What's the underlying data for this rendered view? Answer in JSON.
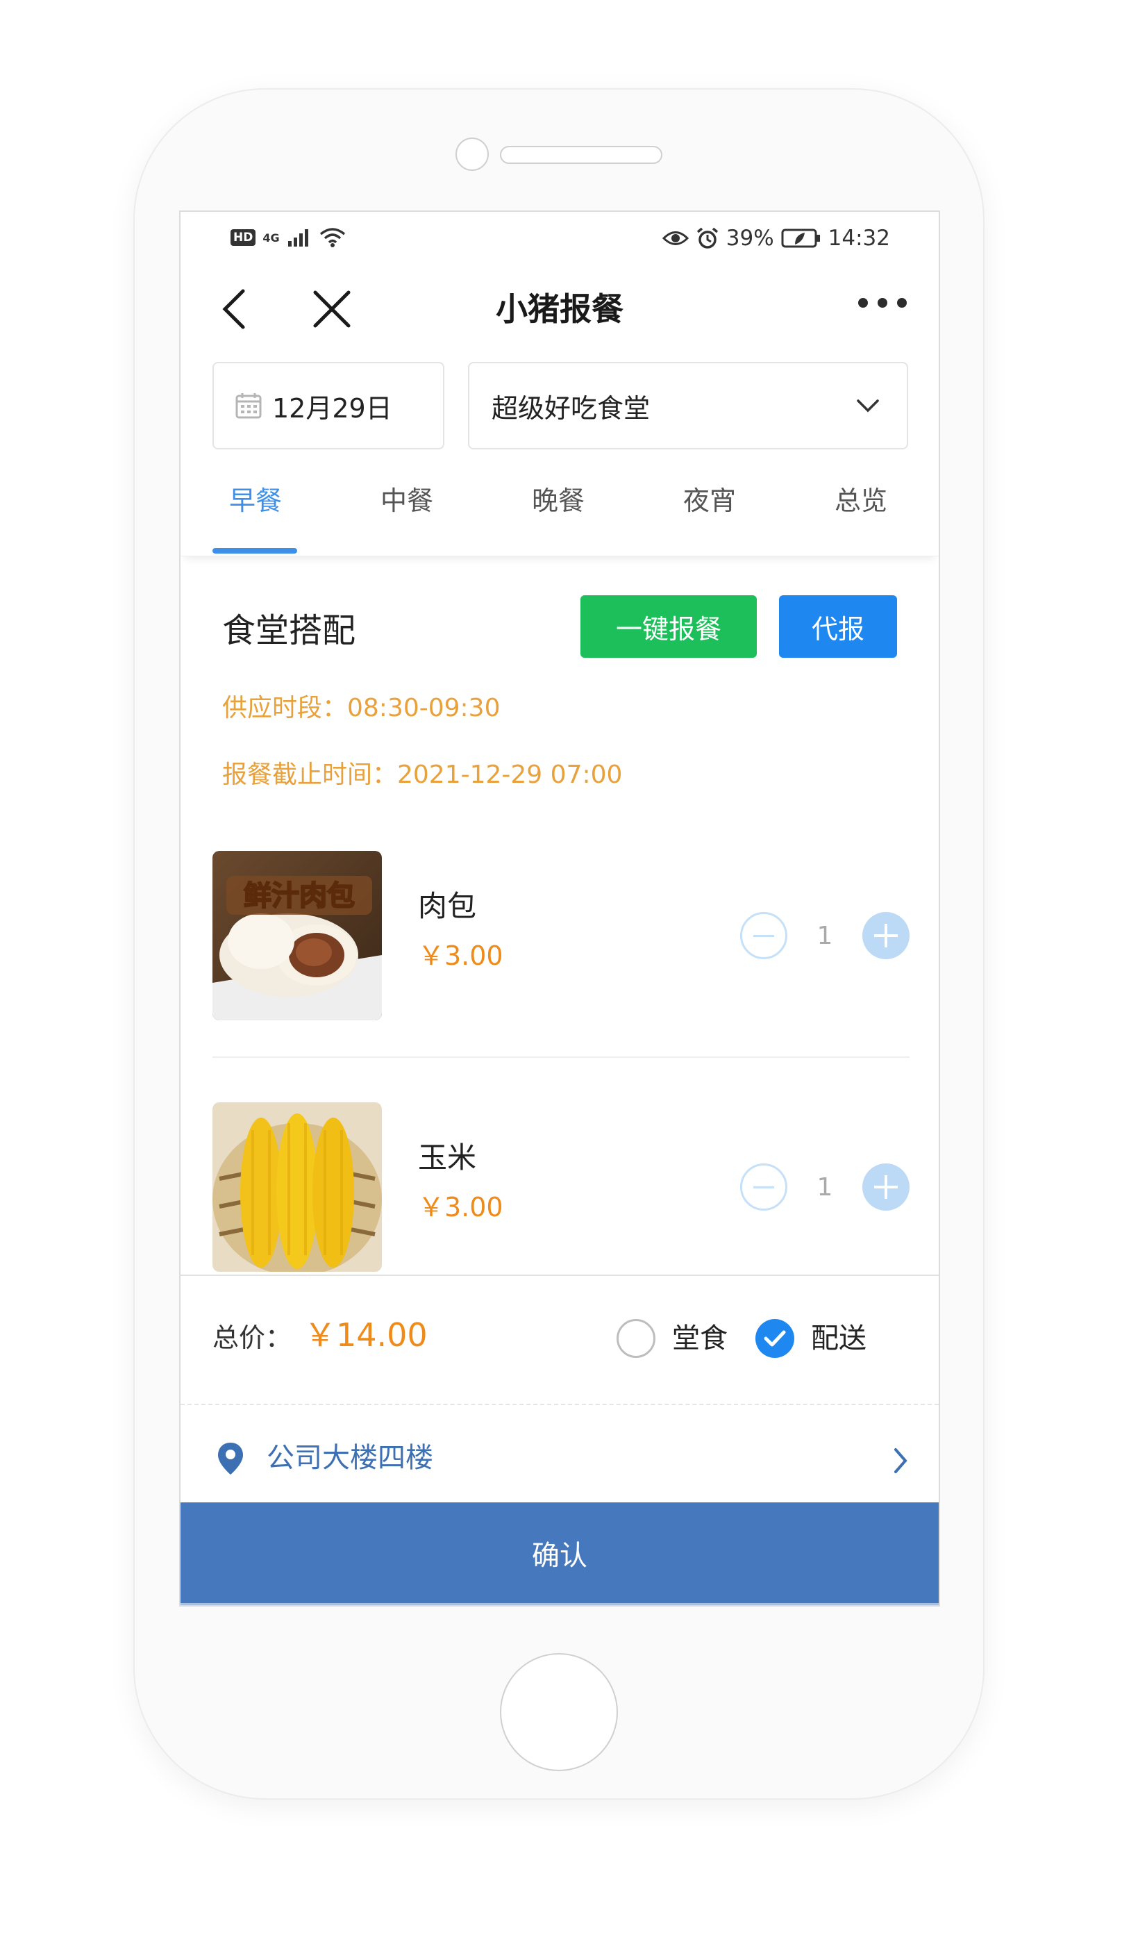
{
  "statusbar": {
    "left_badge": "HD",
    "signal": "4G",
    "battery": "39%",
    "time": "14:32"
  },
  "header": {
    "title": "小猪报餐"
  },
  "filters": {
    "date": "12月29日",
    "canteen": "超级好吃食堂"
  },
  "tabs": [
    {
      "label": "早餐",
      "active": true
    },
    {
      "label": "中餐",
      "active": false
    },
    {
      "label": "晚餐",
      "active": false
    },
    {
      "label": "夜宵",
      "active": false
    },
    {
      "label": "总览",
      "active": false
    }
  ],
  "section": {
    "title": "食堂搭配",
    "one_click_label": "一键报餐",
    "proxy_label": "代报",
    "supply_time": "供应时段：08:30-09:30",
    "deadline": "报餐截止时间：2021-12-29 07:00"
  },
  "foods": [
    {
      "name": "肉包",
      "price": "￥3.00",
      "qty": "1",
      "image_text": "鲜汁肉包"
    },
    {
      "name": "玉米",
      "price": "￥3.00",
      "qty": "1"
    }
  ],
  "summary": {
    "total_label": "总价：",
    "total_value": "￥14.00",
    "option_dine_in": "堂食",
    "option_delivery": "配送",
    "selected": "配送"
  },
  "address": {
    "text": "公司大楼四楼"
  },
  "confirm_label": "确认",
  "colors": {
    "accent_blue": "#1e88f0",
    "green": "#1dbf5a",
    "orange": "#ef8b1a",
    "confirm_bar": "#4678be"
  }
}
